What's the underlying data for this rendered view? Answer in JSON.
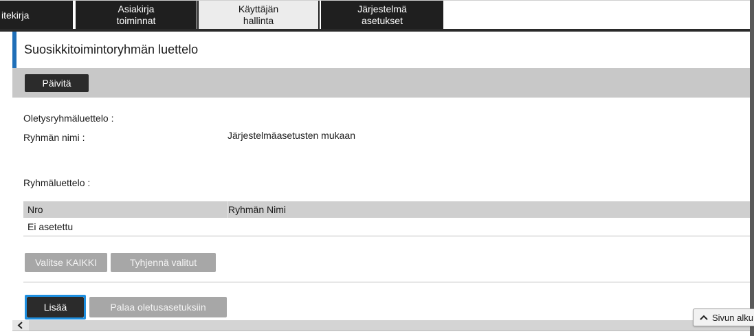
{
  "tabs": [
    {
      "label_lines": [
        "itekirja"
      ]
    },
    {
      "label_lines": [
        "Asiakirja",
        "toiminnat"
      ]
    },
    {
      "label_lines": [
        "Käyttäjän",
        "hallinta"
      ]
    },
    {
      "label_lines": [
        "Järjestelmä",
        "asetukset"
      ]
    }
  ],
  "page": {
    "title": "Suosikkitoimintoryhmän luettelo",
    "update_button": "Päivitä"
  },
  "default_group": {
    "section_label": "Oletysryhmäluettelo :",
    "name_label": "Ryhmän nimi :",
    "name_value": "Järjestelmäasetusten mukaan"
  },
  "group_list": {
    "section_label": "Ryhmäluettelo :",
    "columns": [
      "Nro",
      "Ryhmän Nimi"
    ],
    "empty_row": "Ei asetettu",
    "select_all_button": "Valitse KAIKKI",
    "clear_selected_button": "Tyhjennä valitut"
  },
  "actions": {
    "add_button": "Lisää",
    "restore_defaults_button": "Palaa oletusasetuksiin",
    "page_top_button": "Sivun alku"
  },
  "colors": {
    "accent": "#1f6fb8",
    "focus": "#1e8fe0",
    "tab_dark": "#1f1f1f"
  }
}
